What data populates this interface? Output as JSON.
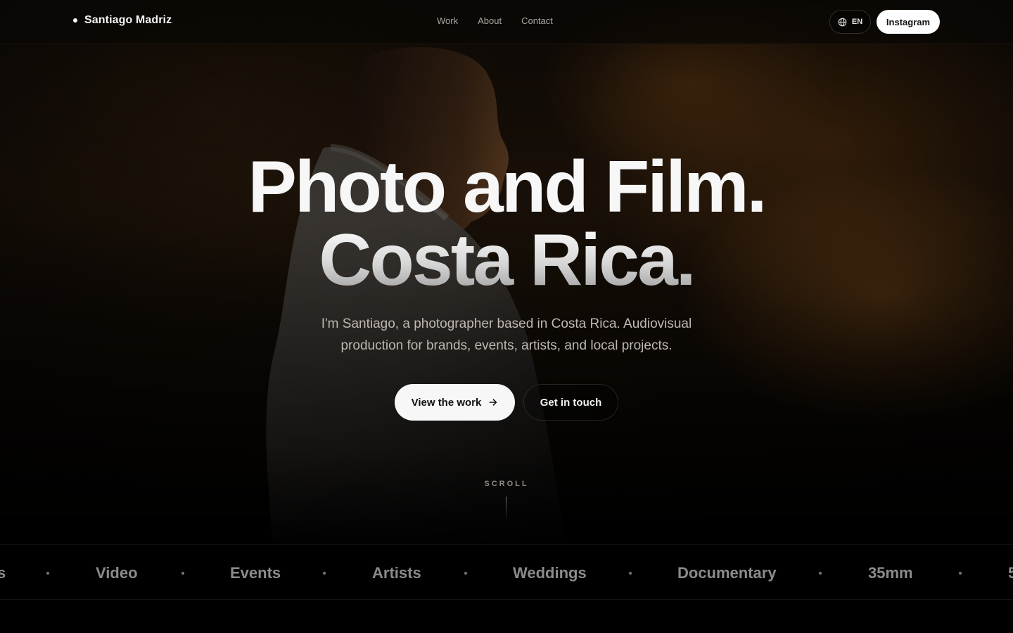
{
  "nav": {
    "brand": "Santiago Madriz",
    "links": [
      "Work",
      "About",
      "Contact"
    ],
    "lang": "EN",
    "instagram": "Instagram"
  },
  "hero": {
    "line1": "Photo and Film.",
    "line2": "Costa Rica.",
    "subtitle": "I'm Santiago, a photographer based in Costa Rica. Audiovisual production for brands, events, artists, and local projects.",
    "cta_primary": "View the work",
    "cta_secondary": "Get in touch",
    "scroll": "SCROLL"
  },
  "marquee": {
    "items": [
      "s",
      "Video",
      "Events",
      "Artists",
      "Weddings",
      "Documentary",
      "35mm",
      "5"
    ]
  },
  "colors": {
    "background": "#000000",
    "primary_button": "#f7f7f7",
    "accent_warm": "#c87828"
  },
  "icons": {
    "brand": "dot-icon",
    "lang": "globe-icon",
    "cta": "arrow-right-icon"
  }
}
